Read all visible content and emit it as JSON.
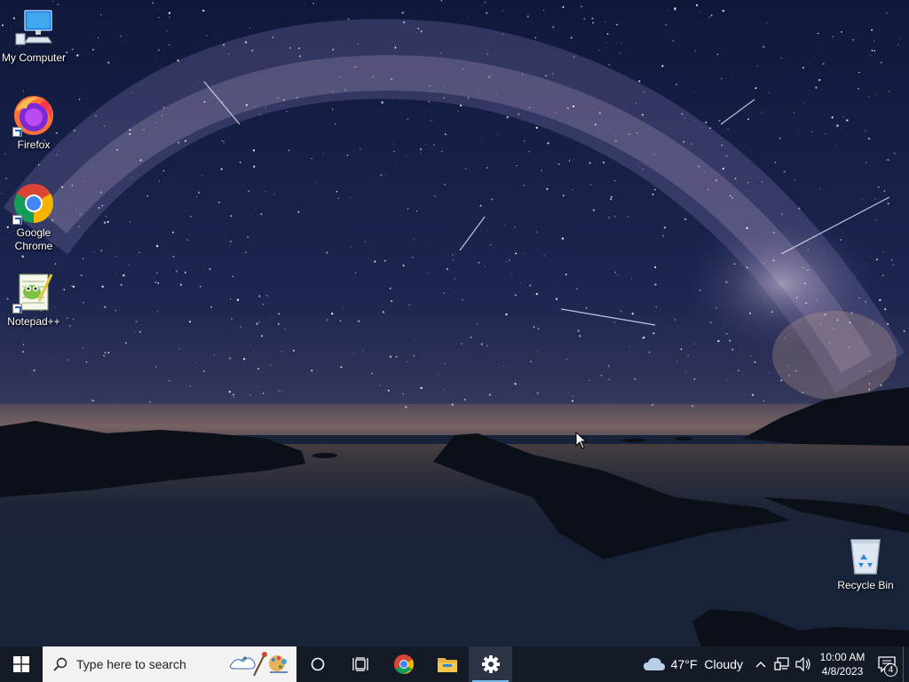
{
  "desktop": {
    "icons": [
      {
        "label": "My Computer",
        "icon": "computer-icon"
      },
      {
        "label": "Firefox",
        "icon": "firefox-icon"
      },
      {
        "label": "Google Chrome",
        "icon": "chrome-icon"
      },
      {
        "label": "Notepad++",
        "icon": "notepadpp-icon"
      },
      {
        "label": "Recycle Bin",
        "icon": "recycle-bin-icon"
      }
    ]
  },
  "taskbar": {
    "search_placeholder": "Type here to search",
    "apps": [
      {
        "name": "Google Chrome",
        "icon": "chrome-icon",
        "active": false
      },
      {
        "name": "File Explorer",
        "icon": "folder-icon",
        "active": false
      },
      {
        "name": "Settings",
        "icon": "gear-icon",
        "active": true
      }
    ],
    "weather": {
      "temp": "47°F",
      "condition": "Cloudy",
      "icon": "cloud-icon"
    },
    "clock": {
      "time": "10:00 AM",
      "date": "4/8/2023"
    },
    "notifications": {
      "count": "4"
    }
  },
  "colors": {
    "taskbar_bg": "#141b26",
    "search_bg": "#f2f2f2",
    "active_indicator": "#76b9ed",
    "windows_logo": "#ffffff"
  }
}
